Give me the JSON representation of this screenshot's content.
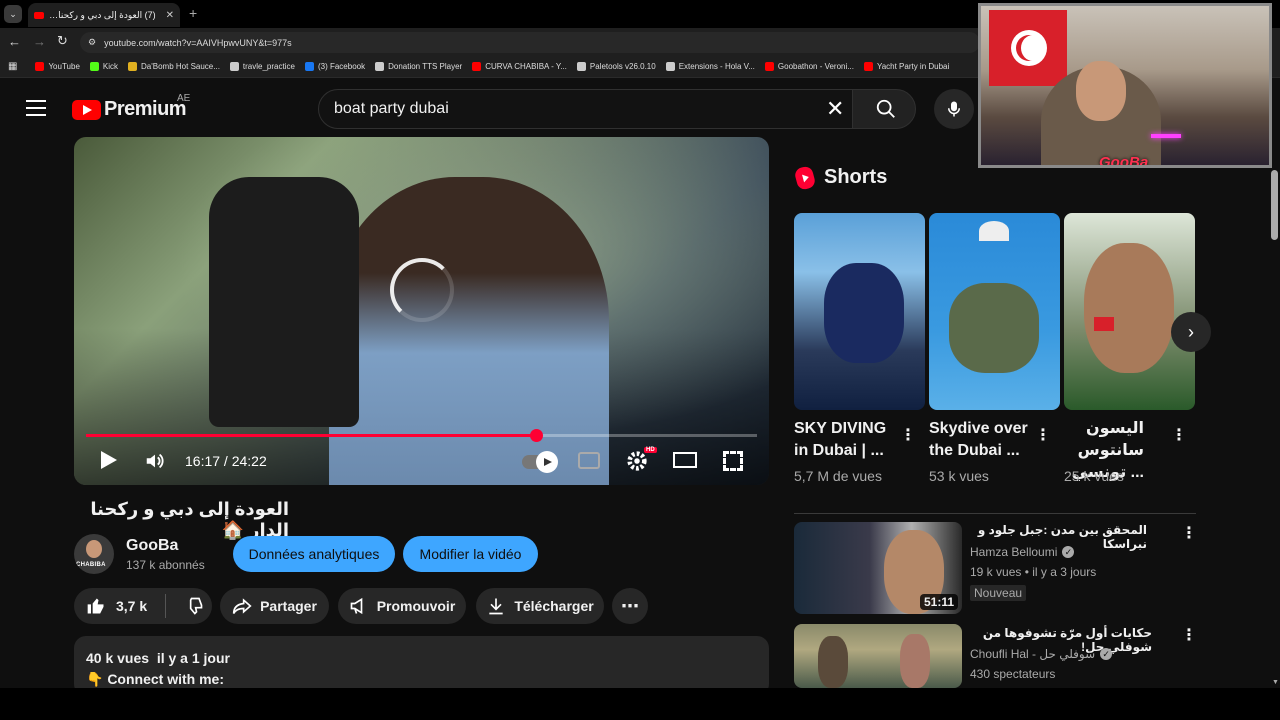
{
  "browser": {
    "tab_title": "(7) العودة إلى دبي و ركحنا الدار 🏠",
    "new_tab": "+",
    "url": "youtube.com/watch?v=AAIVHpwvUNY&t=977s",
    "bookmarks": [
      {
        "label": "YouTube",
        "color": "#ff0000"
      },
      {
        "label": "Kick",
        "color": "#53fc18"
      },
      {
        "label": "Da'Bomb Hot Sauce...",
        "color": "#e0b020"
      },
      {
        "label": "travle_practice",
        "color": "#cccccc"
      },
      {
        "label": "(3) Facebook",
        "color": "#1877f2"
      },
      {
        "label": "Donation TTS Player",
        "color": "#cccccc"
      },
      {
        "label": "CURVA CHABIBA - Y...",
        "color": "#ff0000"
      },
      {
        "label": "Paletools v26.0.10",
        "color": "#cccccc"
      },
      {
        "label": "Extensions - Hola V...",
        "color": "#cccccc"
      },
      {
        "label": "Goobathon - Veroni...",
        "color": "#ff0000"
      },
      {
        "label": "Yacht Party in Dubai",
        "color": "#ff0000"
      }
    ]
  },
  "header": {
    "logo_text": "Premium",
    "region": "AE",
    "search_value": "boat party dubai"
  },
  "player": {
    "time": "16:17 / 24:22",
    "progress": 0.67,
    "hd_badge": "HD"
  },
  "video": {
    "title": "العودة إلى دبي و ركحنا الدار 🏠",
    "channel_name": "GooBa",
    "subscribers": "137 k abonnés",
    "avatar_text": "CHABIBA",
    "analytics_label": "Données analytiques",
    "edit_label": "Modifier la vidéo",
    "likes": "3,7 k",
    "share_label": "Partager",
    "promote_label": "Promouvoir",
    "download_label": "Télécharger",
    "views_date": "40 k vues  il y a 1 jour",
    "description_line": "👇 Connect with me:"
  },
  "overlay": {
    "streamer_tag": "GooBa"
  },
  "shorts": {
    "heading": "Shorts",
    "items": [
      {
        "title": "SKY DIVING in Dubai | ...",
        "views": "5,7 M de vues"
      },
      {
        "title": "Skydive over the Dubai ...",
        "views": "53 k vues"
      },
      {
        "title": "اليسون سانتوس ... تونسي",
        "views": "25 k vues"
      }
    ]
  },
  "recommended": [
    {
      "title": "المحقق بين مدن :جبل جلود و نبراسكا",
      "channel": "Hamza Belloumi",
      "meta": "19 k vues • il y a 3 jours",
      "badge": "Nouveau",
      "duration": "51:11"
    },
    {
      "title": "حكايات أول مرّة تشوفوها من شوفلي حل!",
      "channel": "Choufli Hal - شوفلي حل",
      "meta": "430 spectateurs",
      "badge": "",
      "duration": ""
    }
  ]
}
